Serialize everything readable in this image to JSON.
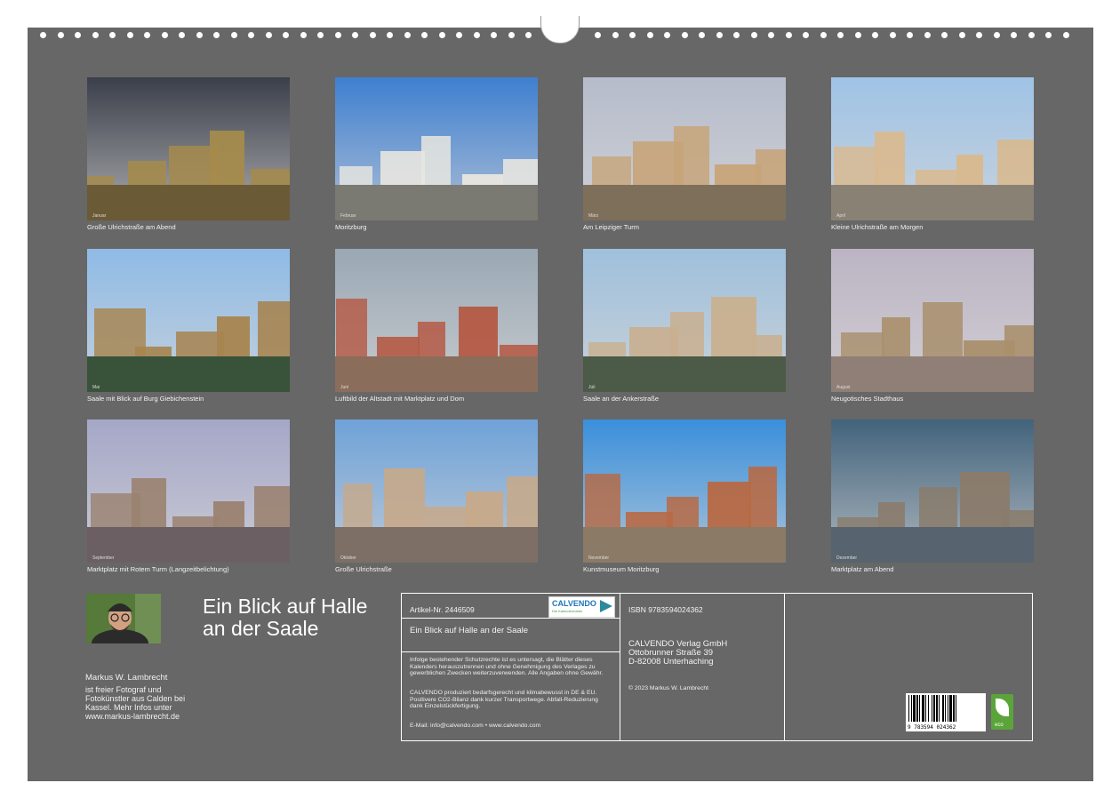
{
  "calendar": {
    "title": "Ein Blick auf Halle an der Saale",
    "author": {
      "name": "Markus W. Lambrecht",
      "bio": "ist freier Fotograf und Fotokünstler aus Calden bei Kassel. Mehr Infos unter www.markus-lambrecht.de"
    },
    "months": [
      {
        "caption": "Große Ulrichstraße am Abend",
        "label": "Januar",
        "colors": {
          "sky": "#3b3f4a",
          "band": "#6b5a36",
          "bldg": "#a58a4c"
        }
      },
      {
        "caption": "Moritzburg",
        "label": "Februar",
        "colors": {
          "sky": "#3f7fd0",
          "band": "#7a7a72",
          "bldg": "#e8e6e0"
        }
      },
      {
        "caption": "Am Leipziger Turm",
        "label": "März",
        "colors": {
          "sky": "#b6bccb",
          "band": "#7e6f5a",
          "bldg": "#c7a57a"
        }
      },
      {
        "caption": "Kleine Ulrichstraße am Morgen",
        "label": "April",
        "colors": {
          "sky": "#9fc3e6",
          "band": "#8a8175",
          "bldg": "#d9b98e"
        }
      },
      {
        "caption": "Saale mit Blick auf Burg Giebichenstein",
        "label": "Mai",
        "colors": {
          "sky": "#8fbbe6",
          "band": "#39523a",
          "bldg": "#a7844f"
        }
      },
      {
        "caption": "Luftbild der Altstadt mit Marktplatz und Dom",
        "label": "Juni",
        "colors": {
          "sky": "#9aa8b4",
          "band": "#8a6d5a",
          "bldg": "#b55a45"
        }
      },
      {
        "caption": "Saale an der Ankerstraße",
        "label": "Juli",
        "colors": {
          "sky": "#9fc0dc",
          "band": "#4c5a48",
          "bldg": "#c9b090"
        }
      },
      {
        "caption": "Neugotisches Stadthaus",
        "label": "August",
        "colors": {
          "sky": "#bcb4c4",
          "band": "#8f7f76",
          "bldg": "#a98f6c"
        }
      },
      {
        "caption": "Marktplatz mit Rotem Turm (Langzeitbelichtung)",
        "label": "September",
        "colors": {
          "sky": "#a5a7c8",
          "band": "#6c5f63",
          "bldg": "#9a8270"
        }
      },
      {
        "caption": "Große Ulrichstraße",
        "label": "Oktober",
        "colors": {
          "sky": "#6fa2d8",
          "band": "#7d6f66",
          "bldg": "#c7a98a"
        }
      },
      {
        "caption": "Kunstmuseum Moritzburg",
        "label": "November",
        "colors": {
          "sky": "#3a8fdb",
          "band": "#8b7a66",
          "bldg": "#b86a44"
        }
      },
      {
        "caption": "Marktplatz am Abend",
        "label": "Dezember",
        "colors": {
          "sky": "#42637c",
          "band": "#57636e",
          "bldg": "#8a7c6c"
        }
      }
    ],
    "publisher_box": {
      "article_no": "Artikel-Nr. 2446509",
      "product_title": "Ein Blick auf Halle an der Saale",
      "logo_text": "CALVENDO",
      "logo_sub": "Die Kalendermarke",
      "legal_text_1": "Infolge bestehender Schutzrechte ist es untersagt, die Blätter dieses Kalenders herauszutrennen und ohne Genehmigung des Verlages zu gewerblichen Zwecken weiterzuverwenden. Alle Angaben ohne Gewähr.",
      "legal_text_2": "CALVENDO produziert bedarfsgerecht und klimabewusst in DE & EU. Positivere CO2-Bilanz dank kurzer Transportwege. Abfall-Reduzierung dank Einzelstückfertigung.",
      "contact": "E-Mail: info@calvendo.com • www.calvendo.com",
      "isbn": "ISBN 9783594024362",
      "publisher_line1": "CALVENDO Verlag GmbH",
      "publisher_line2": "Ottobrunner Straße 39",
      "publisher_line3": "D-82008 Unterhaching",
      "copyright": "© 2023 Markus W. Lambrecht",
      "barcode_number": "9 783594 024362",
      "eco_label": "eco"
    }
  }
}
